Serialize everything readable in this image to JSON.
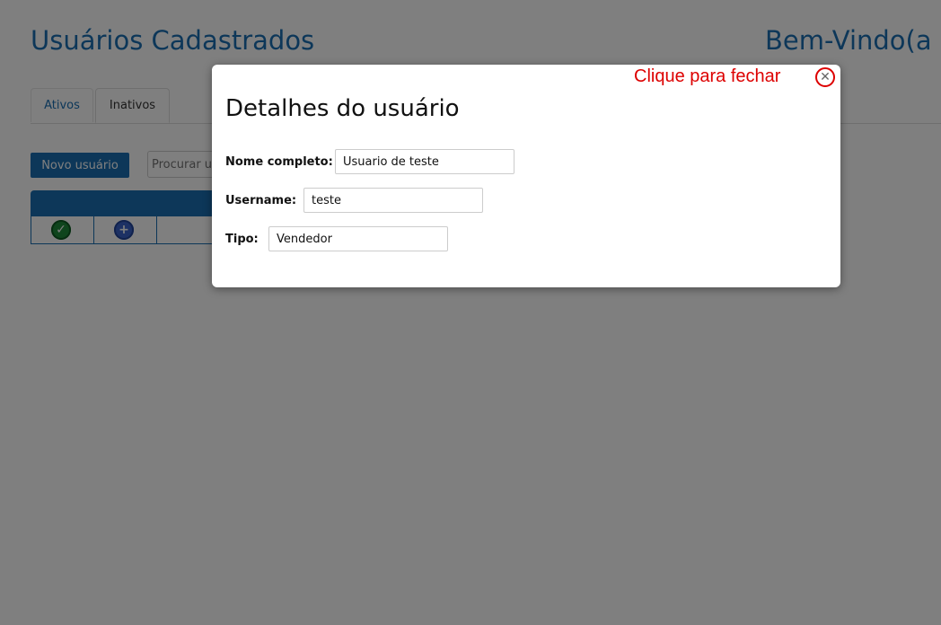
{
  "page": {
    "title": "Usuários Cadastrados",
    "welcome": "Bem-Vindo(a"
  },
  "tabs": [
    {
      "label": "Ativos"
    },
    {
      "label": "Inativos"
    }
  ],
  "toolbar": {
    "new_user_label": "Novo usuário",
    "search_placeholder": "Procurar us"
  },
  "modal": {
    "close_hint": "Clique para fechar",
    "close_symbol": "✕",
    "title": "Detalhes do usuário",
    "fields": [
      {
        "label": "Nome completo:",
        "value": "Usuario de teste"
      },
      {
        "label": "Username:",
        "value": "teste"
      },
      {
        "label": "Tipo:",
        "value": "Vendedor"
      }
    ]
  },
  "icons": {
    "check": "✓",
    "plus": "+"
  },
  "colors": {
    "accent": "#1a6fb3",
    "hint_red": "#dd0000",
    "overlay": "rgba(0,0,0,0.5)"
  }
}
